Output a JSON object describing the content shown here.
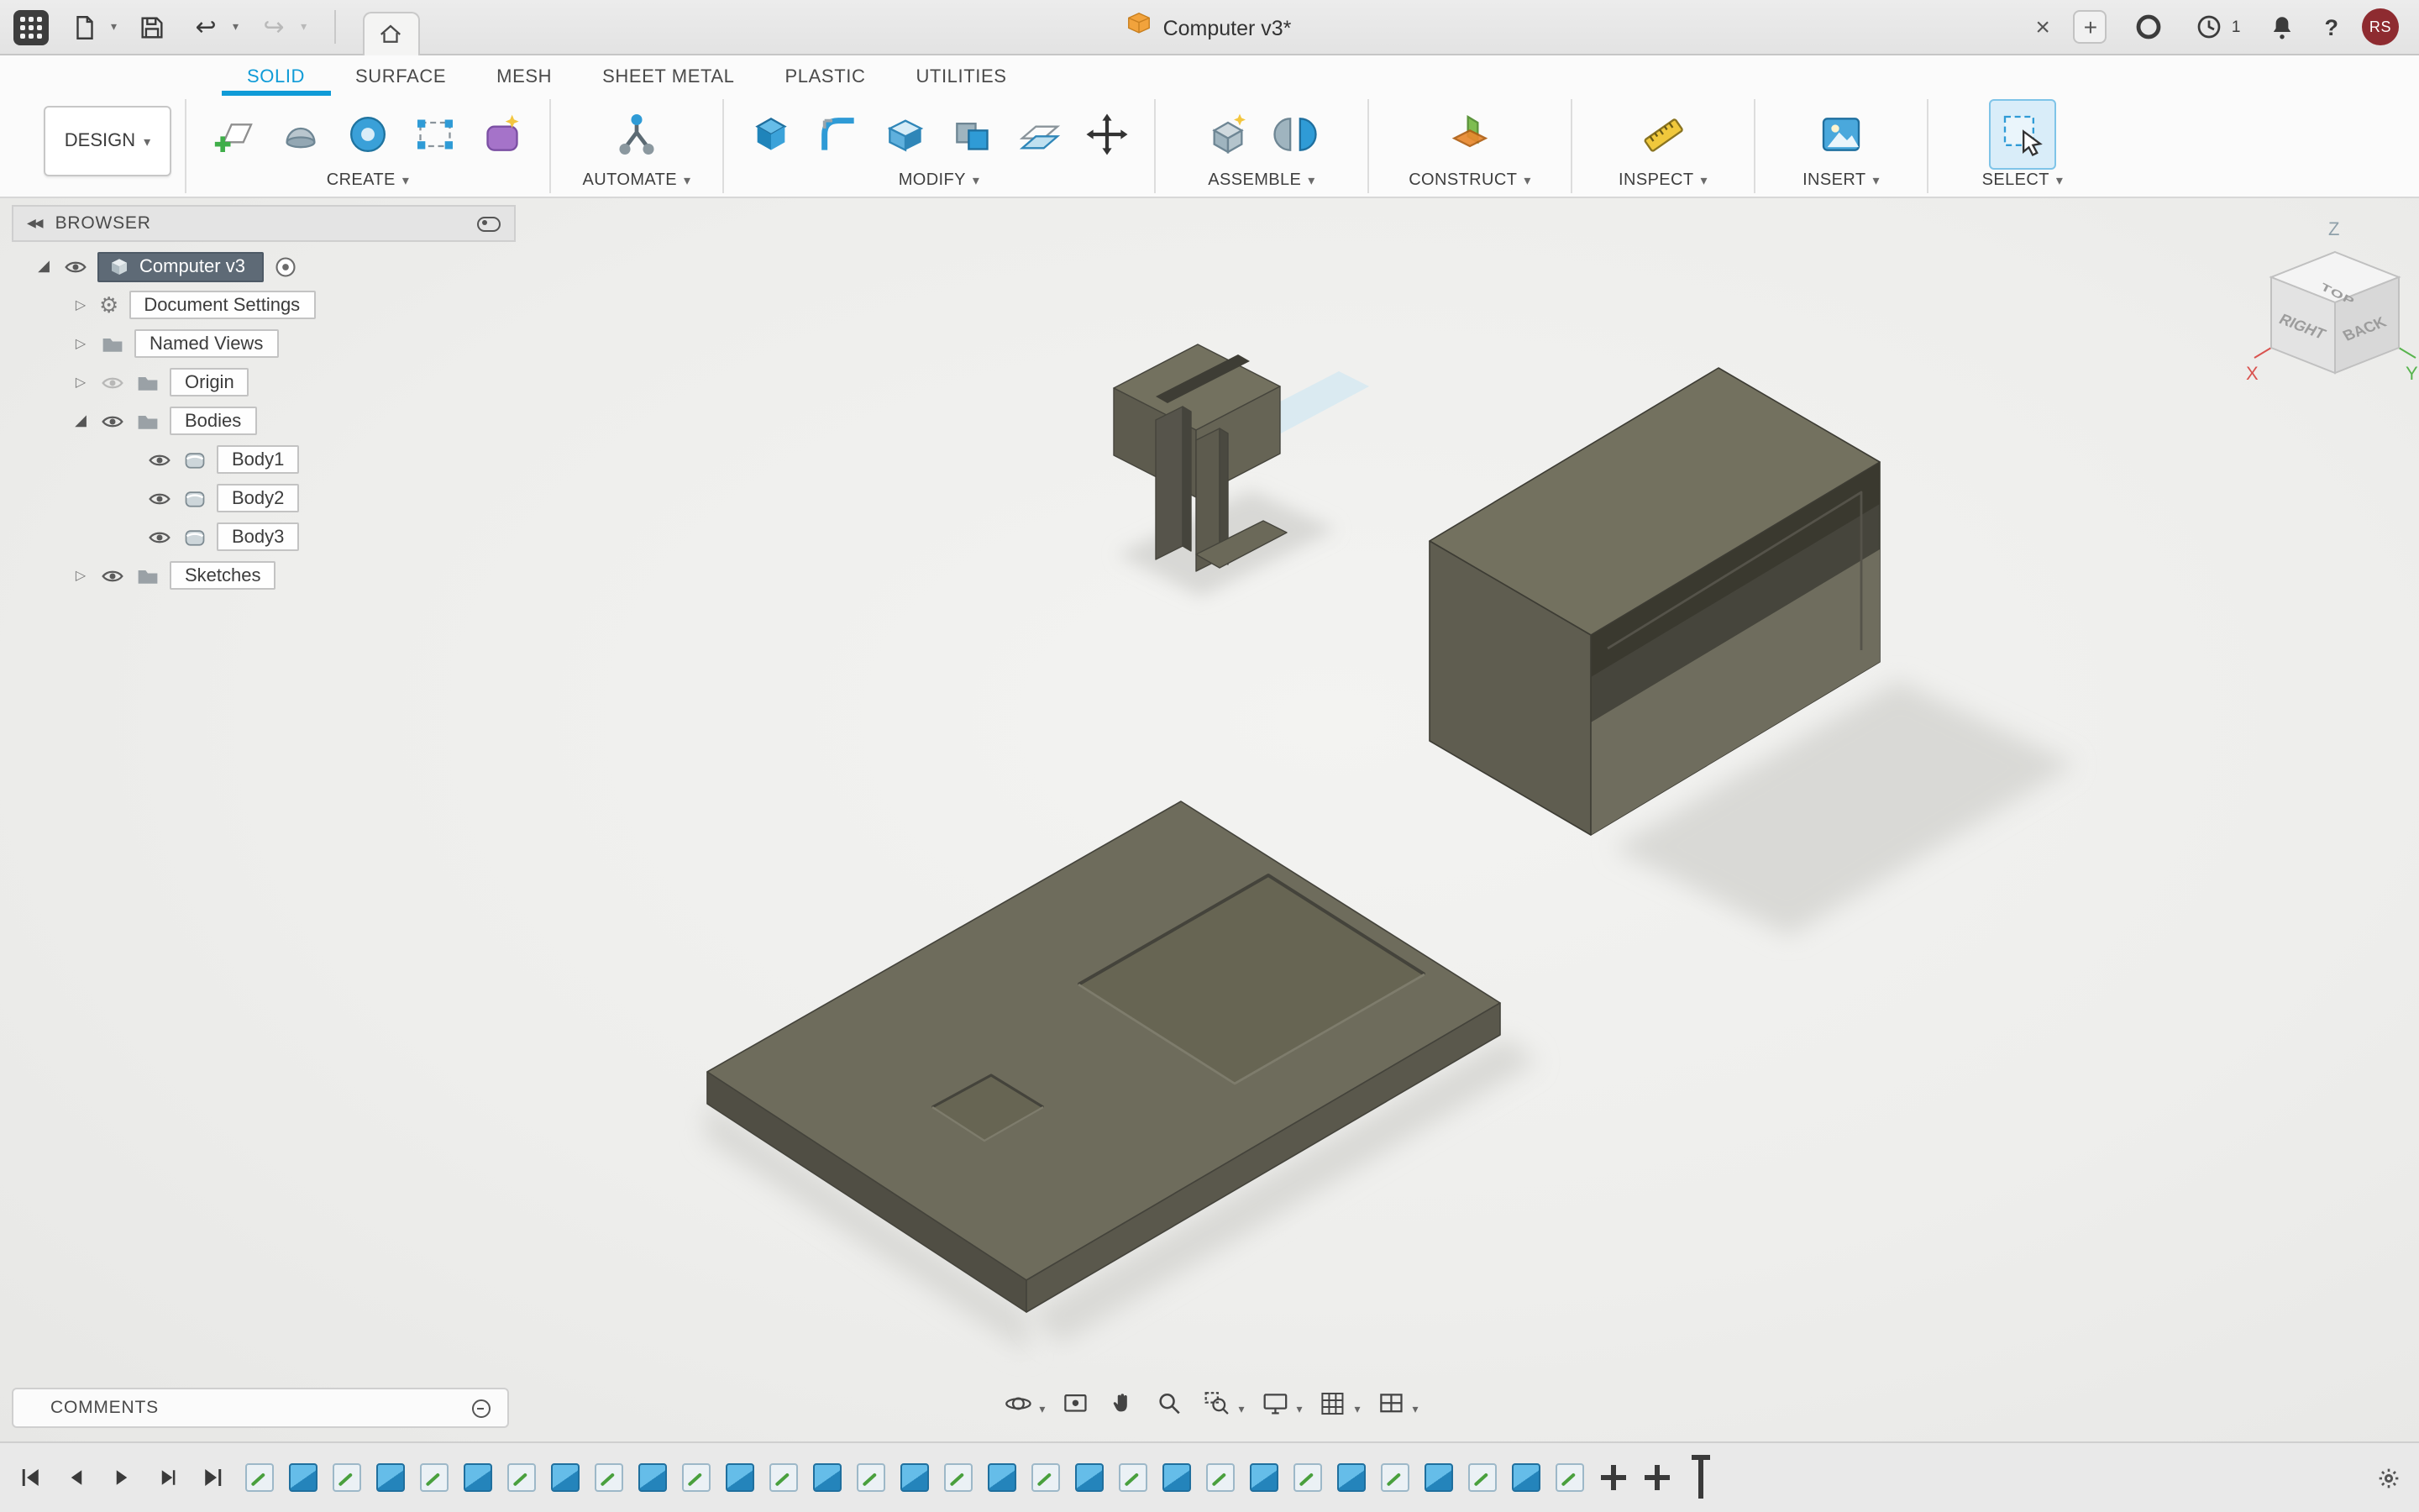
{
  "titlebar": {
    "title": "Computer v3*",
    "notification_count": "1",
    "user_initials": "RS"
  },
  "workspace_switcher": {
    "label": "DESIGN"
  },
  "tabs": [
    {
      "label": "SOLID",
      "active": true
    },
    {
      "label": "SURFACE",
      "active": false
    },
    {
      "label": "MESH",
      "active": false
    },
    {
      "label": "SHEET METAL",
      "active": false
    },
    {
      "label": "PLASTIC",
      "active": false
    },
    {
      "label": "UTILITIES",
      "active": false
    }
  ],
  "toolbar_groups": [
    {
      "label": "CREATE"
    },
    {
      "label": "AUTOMATE"
    },
    {
      "label": "MODIFY"
    },
    {
      "label": "ASSEMBLE"
    },
    {
      "label": "CONSTRUCT"
    },
    {
      "label": "INSPECT"
    },
    {
      "label": "INSERT"
    },
    {
      "label": "SELECT"
    }
  ],
  "browser": {
    "title": "BROWSER",
    "root_label": "Computer v3",
    "items": [
      {
        "label": "Document Settings"
      },
      {
        "label": "Named Views"
      },
      {
        "label": "Origin"
      },
      {
        "label": "Bodies"
      },
      {
        "label": "Body1"
      },
      {
        "label": "Body2"
      },
      {
        "label": "Body3"
      },
      {
        "label": "Sketches"
      }
    ]
  },
  "viewcube": {
    "z": "Z",
    "x": "X",
    "y": "Y",
    "top": "TOP",
    "right": "RIGHT",
    "back": "BACK"
  },
  "comments_bar": {
    "label": "COMMENTS"
  },
  "timeline": {
    "features": [
      "sketch",
      "extrude",
      "sketch",
      "extrude",
      "sketch",
      "extrude",
      "sketch",
      "extrude",
      "sketch",
      "extrude",
      "sketch",
      "extrude",
      "sketch",
      "extrude",
      "sketch",
      "extrude",
      "sketch",
      "extrude",
      "sketch",
      "extrude",
      "sketch",
      "extrude",
      "sketch",
      "extrude",
      "sketch",
      "extrude",
      "sketch",
      "extrude",
      "sketch",
      "extrude",
      "sketch",
      "move",
      "move"
    ]
  },
  "icons": {
    "caret_down": "▾",
    "undo": "↩",
    "redo": "↪",
    "close": "×",
    "plus": "+",
    "question": "?",
    "gear": "⚙",
    "expander_collapsed": "▷",
    "expander_expanded": "◢",
    "collapse_panel": "◀◀"
  },
  "colors": {
    "accent_blue": "#0f9bd7",
    "body_top": "#73715f",
    "body_side": "#5d5b4e",
    "avatar_red": "#8e2b30",
    "axis_x": "#d9534f",
    "axis_y": "#58b44e"
  }
}
